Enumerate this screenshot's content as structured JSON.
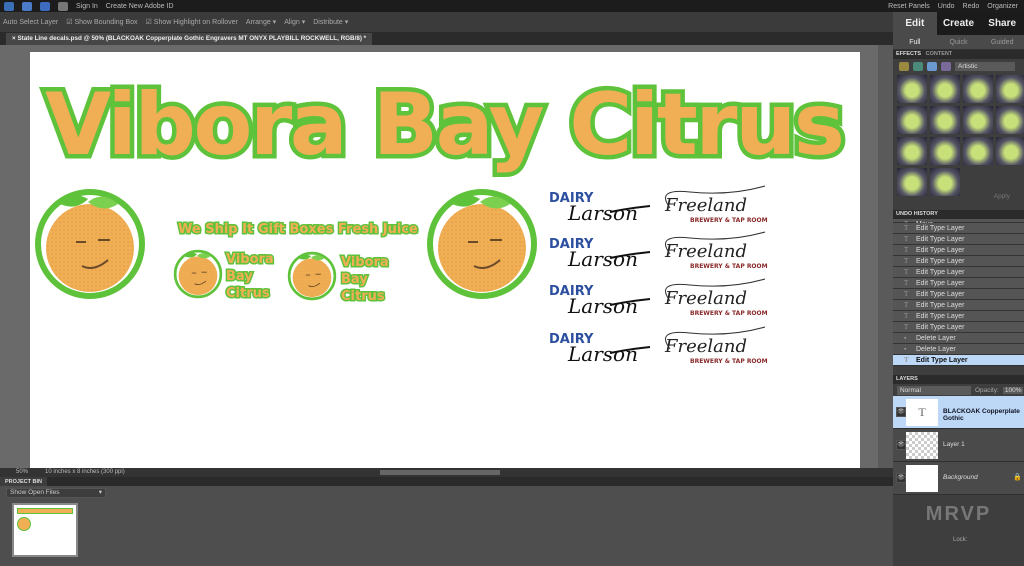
{
  "menubar": {
    "sign_in": "Sign In",
    "create_id": "Create New Adobe ID",
    "reset_panels": "Reset Panels",
    "undo": "Undo",
    "redo": "Redo",
    "organizer": "Organizer"
  },
  "options": {
    "auto_select": "Auto Select Layer",
    "show_bounding": "Show Bounding Box",
    "show_highlight": "Show Highlight on Rollover",
    "arrange": "Arrange",
    "align": "Align",
    "distribute": "Distribute"
  },
  "document_tab": "State Line decals.psd @ 50% (BLACKOAK Copperplate Gothic Engravers MT ONYX PLAYBILL ROCKWELL, RGB/8) *",
  "artwork": {
    "headline": "Vibora Bay Citrus",
    "tags": [
      "We Ship It",
      "Gift Boxes",
      "Fresh Juice"
    ],
    "small_logo": [
      "Vibora",
      "Bay",
      "Citrus"
    ],
    "dairy": "DAIRY",
    "dairy_script": "Larson",
    "freeland": "Freeland",
    "freeland_sub": "BREWERY & TAP ROOM"
  },
  "status": {
    "zoom": "50%",
    "doc_size": "10 inches x 8 inches (300 ppi)"
  },
  "project_bin": {
    "title": "PROJECT BIN",
    "dropdown": "Show Open Files"
  },
  "modes": [
    "Edit",
    "Create",
    "Share"
  ],
  "submodes": [
    "Full",
    "Quick",
    "Guided"
  ],
  "effects": {
    "tabs": [
      "EFFECTS",
      "CONTENT"
    ],
    "category": "Artistic",
    "apply": "Apply"
  },
  "undo_history": {
    "title": "UNDO HISTORY",
    "items": [
      "Move",
      "Edit Type Layer",
      "Edit Type Layer",
      "Edit Type Layer",
      "Edit Type Layer",
      "Edit Type Layer",
      "Edit Type Layer",
      "Edit Type Layer",
      "Edit Type Layer",
      "Edit Type Layer",
      "Edit Type Layer",
      "Delete Layer",
      "Delete Layer",
      "Edit Type Layer"
    ]
  },
  "layers": {
    "title": "LAYERS",
    "blend": "Normal",
    "opacity_label": "Opacity:",
    "opacity": "100%",
    "items": [
      "BLACKOAK Copperplate Gothic",
      "Layer 1",
      "Background"
    ],
    "lock": "Lock:"
  },
  "colors": {
    "orange": "#f0ae55",
    "green": "#5ec23a",
    "dairy_blue": "#2d4fa0",
    "brewery_red": "#8a2a2a",
    "selection": "#bcd8f6"
  }
}
